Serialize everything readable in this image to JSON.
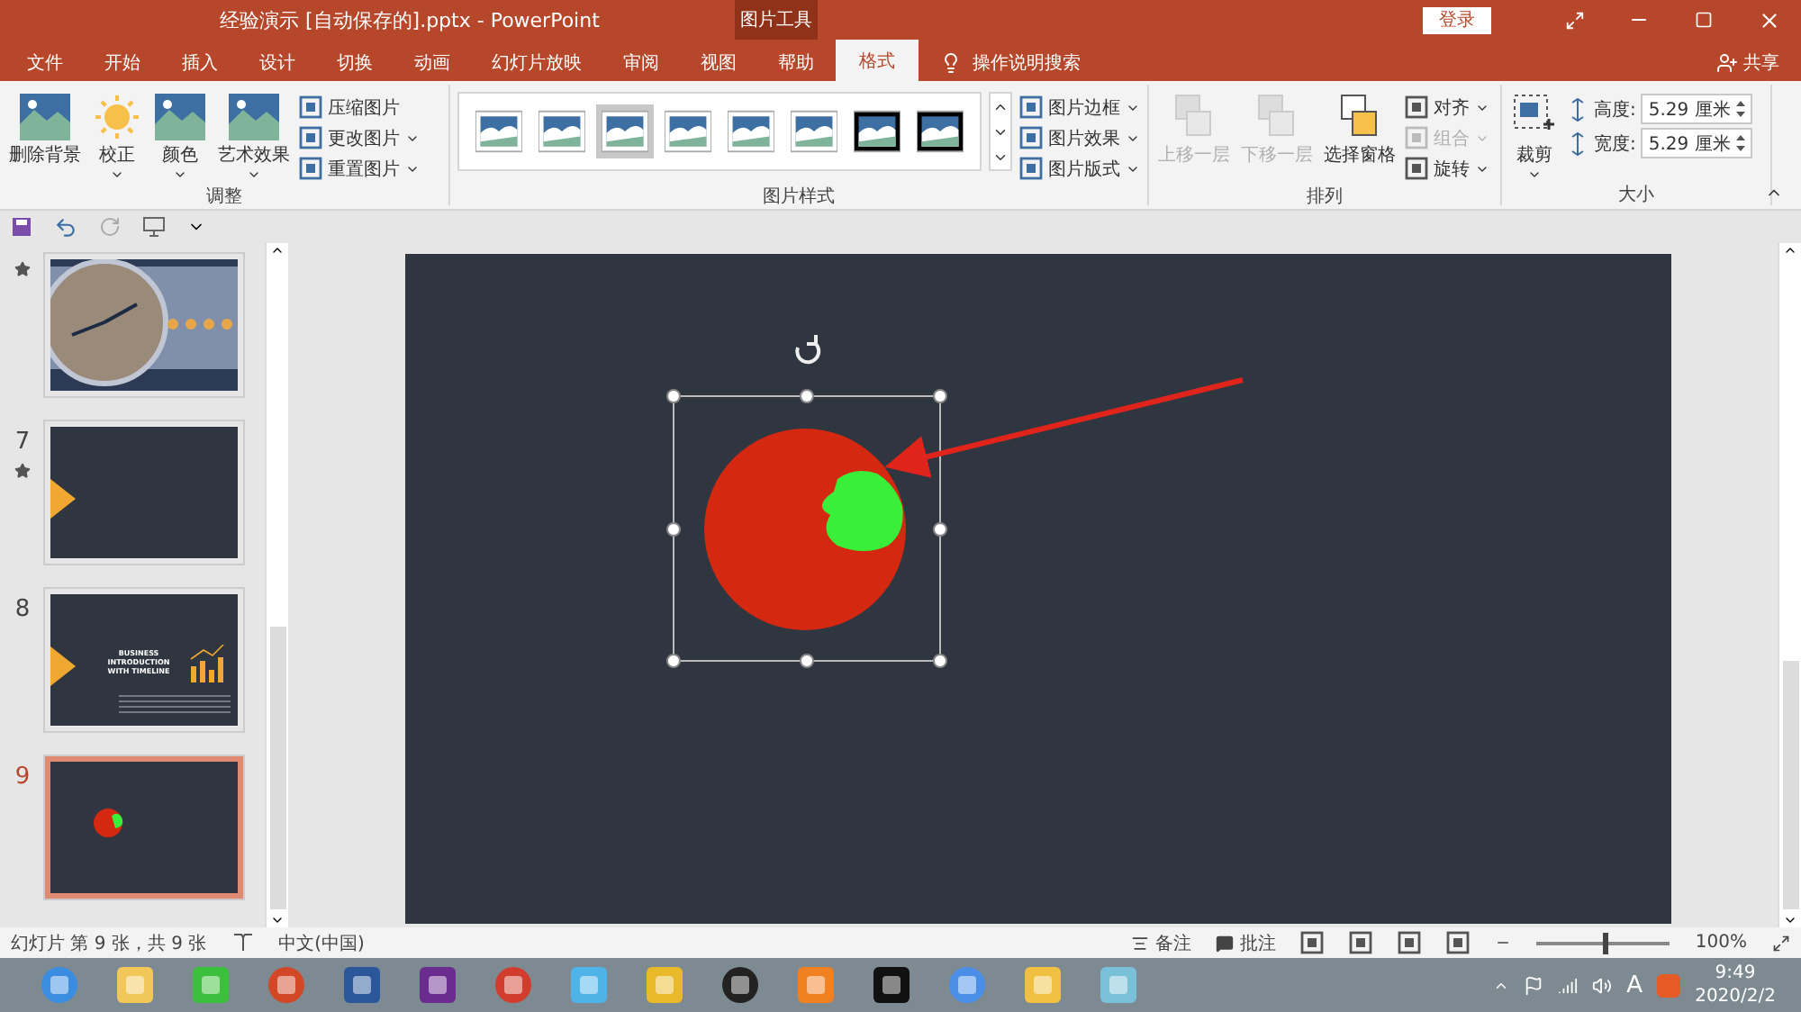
{
  "title_bar": {
    "document_title": "经验演示 [自动保存的].pptx  -  PowerPoint",
    "context_title": "图片工具",
    "login": "登录"
  },
  "tabs": [
    {
      "label": "文件",
      "selected": false
    },
    {
      "label": "开始",
      "selected": false
    },
    {
      "label": "插入",
      "selected": false
    },
    {
      "label": "设计",
      "selected": false
    },
    {
      "label": "切换",
      "selected": false
    },
    {
      "label": "动画",
      "selected": false
    },
    {
      "label": "幻灯片放映",
      "selected": false
    },
    {
      "label": "审阅",
      "selected": false
    },
    {
      "label": "视图",
      "selected": false
    },
    {
      "label": "帮助",
      "selected": false
    },
    {
      "label": "格式",
      "selected": true
    }
  ],
  "search": {
    "label": "操作说明搜索"
  },
  "share": "共享",
  "ribbon": {
    "adjust": {
      "title": "调整",
      "large": [
        {
          "label": "删除背景",
          "dropdown": false
        },
        {
          "label": "校正",
          "dropdown": true
        },
        {
          "label": "颜色",
          "dropdown": true
        },
        {
          "label": "艺术效果",
          "dropdown": true
        }
      ],
      "small": [
        {
          "label": "压缩图片",
          "dropdown": false
        },
        {
          "label": "更改图片",
          "dropdown": true
        },
        {
          "label": "重置图片",
          "dropdown": true
        }
      ]
    },
    "styles": {
      "title": "图片样式",
      "gallery": [
        {
          "selected": false
        },
        {
          "selected": false
        },
        {
          "selected": true
        },
        {
          "selected": false
        },
        {
          "selected": false
        },
        {
          "selected": false
        },
        {
          "selected": false
        },
        {
          "selected": false
        }
      ],
      "small": [
        {
          "label": "图片边框"
        },
        {
          "label": "图片效果"
        },
        {
          "label": "图片版式"
        }
      ]
    },
    "arrange": {
      "title": "排列",
      "large": [
        {
          "label": "上移一层",
          "disabled": true
        },
        {
          "label": "下移一层",
          "disabled": true
        },
        {
          "label": "选择窗格",
          "disabled": false
        }
      ],
      "small": [
        {
          "label": "对齐",
          "disabled": false
        },
        {
          "label": "组合",
          "disabled": true
        },
        {
          "label": "旋转",
          "disabled": false
        }
      ]
    },
    "size": {
      "title": "大小",
      "crop": "裁剪",
      "fields": [
        {
          "label": "高度:",
          "value": "5.29 厘米"
        },
        {
          "label": "宽度:",
          "value": "5.29 厘米"
        }
      ]
    }
  },
  "slides": [
    {
      "star": true,
      "selected": false,
      "kind": "clock"
    },
    {
      "number": "7",
      "star": true,
      "selected": false,
      "kind": "arrow"
    },
    {
      "number": "8",
      "star": false,
      "selected": false,
      "kind": "business",
      "lines": [
        "BUSINESS",
        "INTRODUCTION",
        "WITH TIMELINE"
      ]
    },
    {
      "number": "9",
      "star": false,
      "selected": true,
      "kind": "tomato"
    }
  ],
  "status_bar": {
    "slide_info": "幻灯片 第 9 张，共 9 张",
    "language": "中文(中国)",
    "notes": "备注",
    "comments": "批注",
    "zoom": {
      "level": 0.5
    },
    "zoom_text": "100%"
  },
  "taskbar": {
    "ime": "A",
    "time": "9:49",
    "date": "2020/2/2"
  }
}
